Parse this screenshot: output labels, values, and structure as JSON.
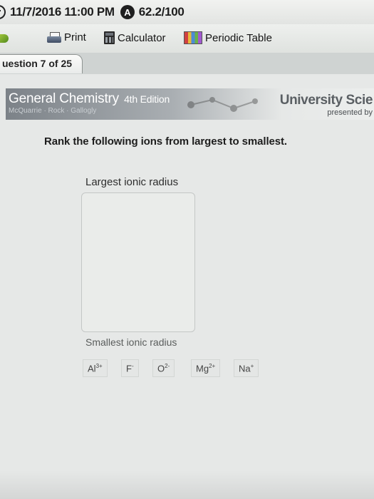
{
  "status_bar": {
    "datetime": "11/7/2016 11:00 PM",
    "score_badge": "A",
    "score": "62.2/100"
  },
  "toolbar": {
    "print_label": "Print",
    "calculator_label": "Calculator",
    "periodic_table_label": "Periodic Table"
  },
  "question_tab": {
    "label": "uestion 7 of 25"
  },
  "banner": {
    "title": "General Chemistry",
    "edition": "4th Edition",
    "authors": "McQuarrie · Rock · Gallogly",
    "publisher": "University Scie",
    "presented_by": "presented by"
  },
  "question": {
    "prompt": "Rank the following ions from largest to smallest.",
    "largest_label": "Largest ionic radius",
    "smallest_label": "Smallest ionic radius"
  },
  "ions": [
    {
      "symbol": "Al",
      "charge": "3+"
    },
    {
      "symbol": "F",
      "charge": "-"
    },
    {
      "symbol": "O",
      "charge": "2-"
    },
    {
      "symbol": "Mg",
      "charge": "2+"
    },
    {
      "symbol": "Na",
      "charge": "+"
    }
  ]
}
